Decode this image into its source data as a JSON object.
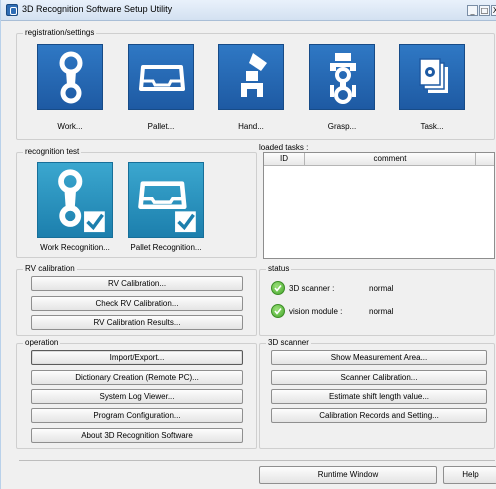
{
  "window": {
    "title": "3D Recognition Software Setup Utility",
    "minimize": "_",
    "maximize": "□",
    "close": "X"
  },
  "registration": {
    "legend": "registration/settings",
    "items": [
      {
        "label": "Work...",
        "icon": "work-icon"
      },
      {
        "label": "Pallet...",
        "icon": "pallet-icon"
      },
      {
        "label": "Hand...",
        "icon": "hand-icon"
      },
      {
        "label": "Grasp...",
        "icon": "grasp-icon"
      },
      {
        "label": "Task...",
        "icon": "task-icon"
      }
    ]
  },
  "recognition": {
    "legend": "recognition test",
    "items": [
      {
        "label": "Work Recognition...",
        "icon": "work-recognition-icon"
      },
      {
        "label": "Pallet Recognition...",
        "icon": "pallet-recognition-icon"
      }
    ]
  },
  "loaded_tasks": {
    "legend": "loaded tasks :",
    "columns": [
      "ID",
      "comment"
    ]
  },
  "rv_calibration": {
    "legend": "RV calibration",
    "buttons": [
      "RV Calibration...",
      "Check RV Calibration...",
      "RV Calibration Results..."
    ]
  },
  "status": {
    "legend": "status",
    "rows": [
      {
        "label": "3D scanner :",
        "value": "normal"
      },
      {
        "label": "vision module :",
        "value": "normal"
      }
    ]
  },
  "operation": {
    "legend": "operation",
    "buttons": [
      "Import/Export...",
      "Dictionary Creation (Remote PC)...",
      "System Log Viewer...",
      "Program Configuration...",
      "About 3D Recognition Software"
    ]
  },
  "scanner": {
    "legend": "3D scanner",
    "buttons": [
      "Show Measurement Area...",
      "Scanner Calibration...",
      "Estimate shift length value...",
      "Calibration Records and Setting..."
    ]
  },
  "footer": {
    "runtime": "Runtime Window",
    "help": "Help"
  },
  "colors": {
    "tile_blue": "#1e5aa3",
    "tile_teal": "#1c7fad",
    "status_green": "#45a82b"
  }
}
